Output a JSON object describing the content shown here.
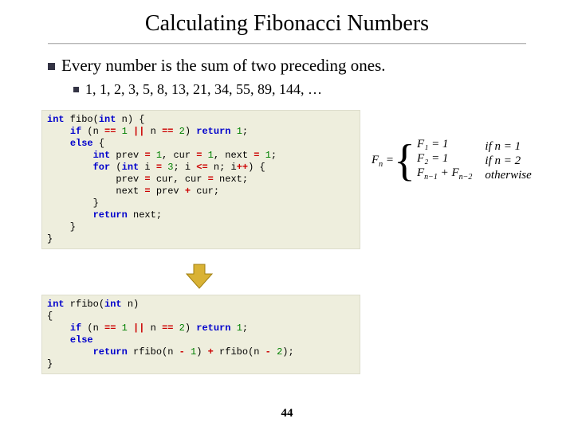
{
  "title": "Calculating Fibonacci Numbers",
  "bullet1": "Every number is the sum of two preceding ones.",
  "bullet2": "1, 1, 2, 3, 5, 8, 13, 21, 34, 55, 89, 144, …",
  "formula": {
    "lhs": "F",
    "lhs_sub": "n",
    "eq": " = ",
    "r1": "F₁ = 1",
    "r2": "F₂ = 1",
    "r3a": "F",
    "r3a_sub": "n−1",
    "r3plus": " + ",
    "r3b": "F",
    "r3b_sub": "n−2",
    "c1": "if n = 1",
    "c2": "if n = 2",
    "c3": "otherwise"
  },
  "code1": {
    "l1a": "int",
    "l1b": " fibo(",
    "l1c": "int",
    "l1d": " n) {",
    "l2a": "    ",
    "l2b": "if",
    "l2c": " (n ",
    "l2d": "==",
    "l2e": " ",
    "l2f": "1",
    "l2g": " ",
    "l2h": "||",
    "l2i": " n ",
    "l2j": "==",
    "l2k": " ",
    "l2l": "2",
    "l2m": ") ",
    "l2n": "return",
    "l2o": " ",
    "l2p": "1",
    "l2q": ";",
    "l3a": "    ",
    "l3b": "else",
    "l3c": " {",
    "l4a": "        ",
    "l4b": "int",
    "l4c": " prev ",
    "l4d": "=",
    "l4e": " ",
    "l4f": "1",
    "l4g": ", cur ",
    "l4h": "=",
    "l4i": " ",
    "l4j": "1",
    "l4k": ", next ",
    "l4l": "=",
    "l4m": " ",
    "l4n": "1",
    "l4o": ";",
    "l5a": "        ",
    "l5b": "for",
    "l5c": " (",
    "l5d": "int",
    "l5e": " i ",
    "l5f": "=",
    "l5g": " ",
    "l5h": "3",
    "l5i": "; i ",
    "l5j": "<=",
    "l5k": " n; i",
    "l5l": "++",
    "l5m": ") {",
    "l6a": "            prev ",
    "l6b": "=",
    "l6c": " cur, cur ",
    "l6d": "=",
    "l6e": " next;",
    "l7a": "            next ",
    "l7b": "=",
    "l7c": " prev ",
    "l7d": "+",
    "l7e": " cur;",
    "l8": "        }",
    "l9a": "        ",
    "l9b": "return",
    "l9c": " next;",
    "l10": "    }",
    "l11": "}"
  },
  "code2": {
    "l1a": "int",
    "l1b": " rfibo(",
    "l1c": "int",
    "l1d": " n)",
    "l2": "{",
    "l3a": "    ",
    "l3b": "if",
    "l3c": " (n ",
    "l3d": "==",
    "l3e": " ",
    "l3f": "1",
    "l3g": " ",
    "l3h": "||",
    "l3i": " n ",
    "l3j": "==",
    "l3k": " ",
    "l3l": "2",
    "l3m": ") ",
    "l3n": "return",
    "l3o": " ",
    "l3p": "1",
    "l3q": ";",
    "l4a": "    ",
    "l4b": "else",
    "l5a": "        ",
    "l5b": "return",
    "l5c": " rfibo(n ",
    "l5d": "-",
    "l5e": " ",
    "l5f": "1",
    "l5g": ") ",
    "l5h": "+",
    "l5i": " rfibo(n ",
    "l5j": "-",
    "l5k": " ",
    "l5l": "2",
    "l5m": ");",
    "l6": "}"
  },
  "page_number": "44"
}
